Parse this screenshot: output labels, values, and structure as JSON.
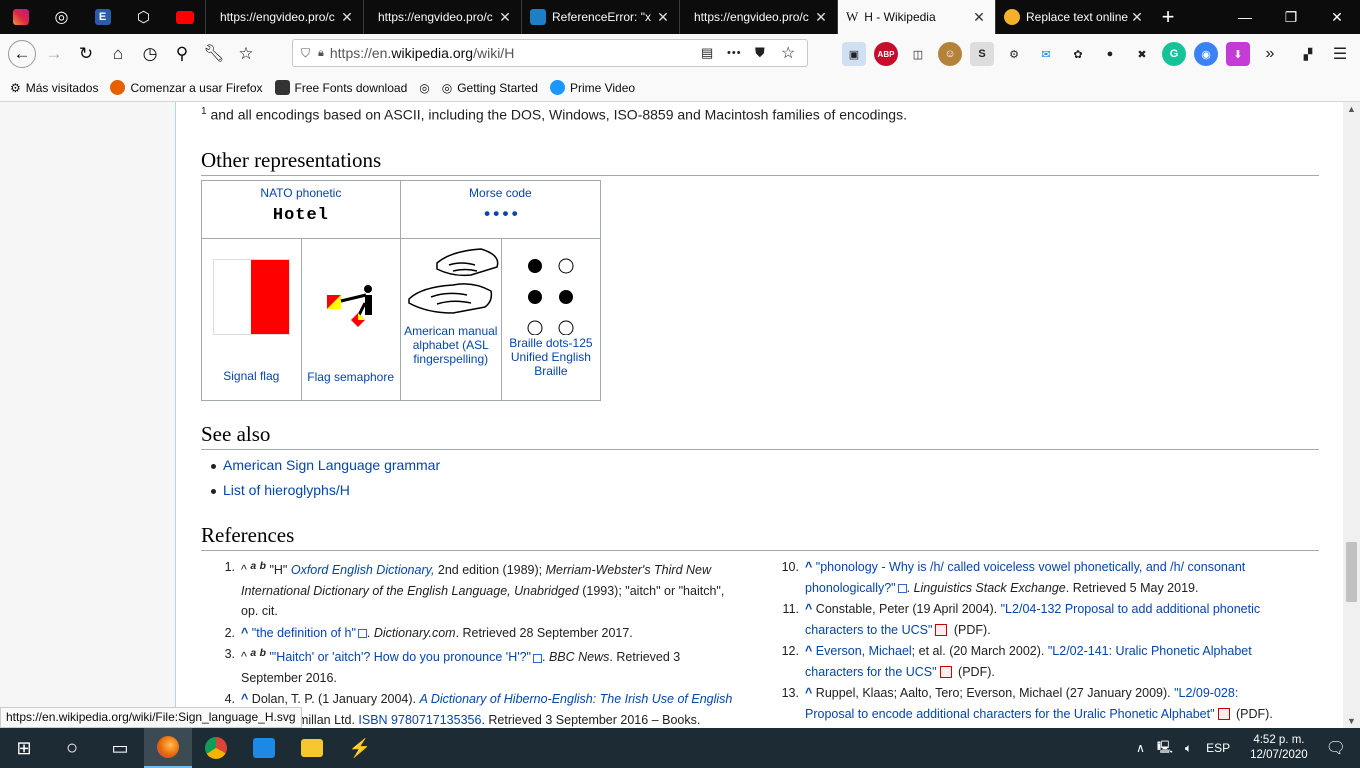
{
  "tabs": {
    "pinned": [
      "instagram-icon",
      "globe-icon",
      "engvideo-audio-icon",
      "codepen-icon",
      "youtube-icon"
    ],
    "items": [
      {
        "title": "https://engvideo.pro/c",
        "active": false
      },
      {
        "title": "https://engvideo.pro/c",
        "active": false
      },
      {
        "title": "ReferenceError: \"x",
        "active": false
      },
      {
        "title": "https://engvideo.pro/c",
        "active": false
      },
      {
        "title": "H - Wikipedia",
        "active": true
      },
      {
        "title": "Replace text online",
        "active": false
      }
    ]
  },
  "navbar": {
    "url_prefix": "https://en.",
    "url_domain": "wikipedia.org",
    "url_path": "/wiki/H",
    "more": "•••"
  },
  "bookmarks": [
    "Más visitados",
    "Comenzar a usar Firefox",
    "Free Fonts download",
    "",
    "Getting Started",
    "Prime Video"
  ],
  "page": {
    "footnote_num": "1",
    "footnote": " and all encodings based on ASCII, including the DOS, Windows, ISO-8859 and Macintosh families of encodings.",
    "other_rep_heading": "Other representations",
    "nato_label": "NATO phonetic",
    "nato_value": "Hotel",
    "morse_label": "Morse code",
    "morse_value": "••••",
    "signal_flag": "Signal flag",
    "flag_semaphore": "Flag semaphore",
    "asl": "American manual alphabet (ASL fingerspelling)",
    "braille": "Braille dots-125 Unified English Braille",
    "see_also_heading": "See also",
    "see_also": [
      "American Sign Language grammar",
      "List of hieroglyphs/H"
    ],
    "references_heading": "References"
  },
  "refs_left": [
    {
      "num": "1.",
      "html": "^ <sup><i><b>a</b></i></sup> <sup><i><b>b</b></i></sup> \"H\" <i class=\"lnk\">Oxford English Dictionary,</i> 2nd edition (1989); <i>Merriam-Webster's Third New International Dictionary of the English Language, Unabridged</i> (1993); \"aitch\" or \"haitch\", op. cit."
    },
    {
      "num": "2.",
      "html": "<b class=\"lnk\">^</b> <span class=\"lnk\">\"the definition of h\"</span><span class=\"ext-ic\"></span>. <i>Dictionary.com</i>. Retrieved 28 September 2017."
    },
    {
      "num": "3.",
      "html": "^ <sup><i><b>a</b></i></sup> <sup><i><b>b</b></i></sup> <span class=\"lnk\">\"'Haitch' or 'aitch'? How do you pronounce 'H'?\"</span><span class=\"ext-ic\"></span>. <i>BBC News</i>. Retrieved 3 September 2016."
    },
    {
      "num": "4.",
      "html": "<b class=\"lnk\">^</b> Dolan, T. P. (1 January 2004). <i class=\"lnk\">A Dictionary of Hiberno-English: The Irish Use of English</i> Gill &amp; Macmillan Ltd. <span class=\"lnk\">ISBN 9780717135356</span>. Retrieved 3 September 2016 – Books."
    }
  ],
  "refs_right": [
    {
      "num": "10.",
      "html": "<b class=\"lnk\">^</b> <span class=\"lnk\">\"phonology - Why is /h/ called voiceless vowel phonetically, and /h/ consonant phonologically?\"</span><span class=\"ext-ic\"></span>. <i>Linguistics Stack Exchange</i>. Retrieved 5 May 2019."
    },
    {
      "num": "11.",
      "html": "<b class=\"lnk\">^</b> Constable, Peter (19 April 2004). <span class=\"lnk\">\"L2/04-132 Proposal to add additional phonetic characters to the UCS\"</span><span class=\"pdf\"></span> (PDF)."
    },
    {
      "num": "12.",
      "html": "<b class=\"lnk\">^</b> <span class=\"lnk\">Everson, Michael</span>; et al. (20 March 2002). <span class=\"lnk\">\"L2/02-141: Uralic Phonetic Alphabet characters for the UCS\"</span><span class=\"pdf\"></span> (PDF)."
    },
    {
      "num": "13.",
      "html": "<b class=\"lnk\">^</b> Ruppel, Klaas; Aalto, Tero; Everson, Michael (27 January 2009). <span class=\"lnk\">\"L2/09-028: Proposal to encode additional characters for the Uralic Phonetic Alphabet\"</span><span class=\"pdf\"></span> (PDF)."
    }
  ],
  "status_url": "https://en.wikipedia.org/wiki/File:Sign_language_H.svg",
  "taskbar": {
    "lang": "ESP",
    "time": "4:52 p. m.",
    "date": "12/07/2020"
  }
}
